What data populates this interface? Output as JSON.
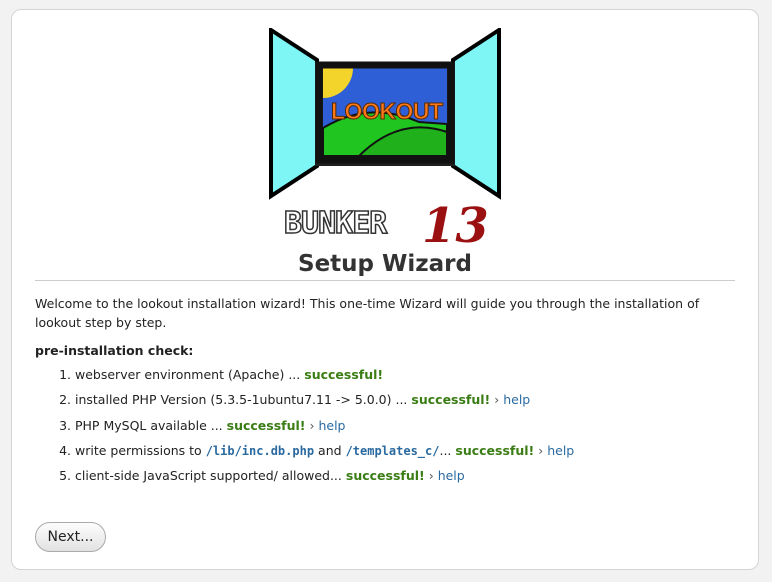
{
  "logo": {
    "text": "LOOKOUT"
  },
  "brand": {
    "word": "BUNKER",
    "number": "13"
  },
  "title": "Setup Wizard",
  "intro": "Welcome to the lookout installation wizard! This one-time Wizard will guide you through the installation of lookout step by step.",
  "check_label": "pre-installation check:",
  "checks": [
    {
      "text": "webserver environment (Apache) ...",
      "status": "successful!"
    },
    {
      "text": "installed PHP Version (5.3.5-1ubuntu7.11 -> 5.0.0) ...",
      "status": "successful!",
      "sep": "›",
      "help": "help"
    },
    {
      "text": "PHP MySQL available ...",
      "status": "successful!",
      "sep": "›",
      "help": "help"
    },
    {
      "pre": "write permissions to",
      "path1": "/lib/inc.db.php",
      "mid": "and",
      "path2": "/templates_c/",
      "post": "...",
      "status": "successful!",
      "sep": "›",
      "help": "help"
    },
    {
      "text": "client-side JavaScript supported/ allowed...",
      "status": "successful!",
      "sep": "›",
      "help": "help"
    }
  ],
  "next_label": "Next..."
}
